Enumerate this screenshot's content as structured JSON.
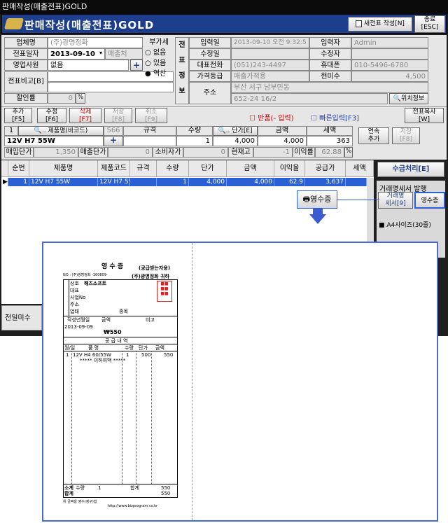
{
  "window_title": "판매작성(매출전표)GOLD",
  "header": {
    "title": "판매작성(매출전표)GOLD",
    "new_label": "새전표 작성[N]",
    "close_label": "종료\n[ESC]"
  },
  "form": {
    "company_label": "업체명",
    "company_value": "(주)광명정화",
    "date_label": "전표일자",
    "date_value": "2013-09-10",
    "sale_placeholder": "매출처",
    "sales_label": "영업사원",
    "sales_value": "없음",
    "plus": "+",
    "memo_label": "전표비고[B]",
    "discount_label": "할인률",
    "discount_value": "0",
    "pct": "%",
    "vat_label": "부가세",
    "vat_options": [
      "없음",
      "있음",
      "역산"
    ],
    "vat_selected": "역산"
  },
  "info": {
    "side": [
      "전",
      "표",
      "정",
      "보"
    ],
    "rows": [
      {
        "l1": "입력일",
        "v1": "2013-09-10 오전 9:32:5",
        "l2": "입력자",
        "v2": "Admin"
      },
      {
        "l1": "수정일",
        "v1": "",
        "l2": "수정자",
        "v2": ""
      },
      {
        "l1": "대표전화",
        "v1": "(051)243-4497",
        "l2": "휴대폰",
        "v2": "010-5496-6780"
      },
      {
        "l1": "가격등급",
        "v1": "매출가적용",
        "l2": "현미수",
        "v2": "4,500"
      }
    ],
    "addr_label": "주소",
    "addr1": "부산 서구 남부민동",
    "addr2": "652-24 16/2",
    "location_btn": "위치정보"
  },
  "toolbar": {
    "add": "추가\n[F5]",
    "edit": "수정\n[F6]",
    "del": "삭제\n[F7]",
    "save": "저장\n[F8]",
    "cancel": "취소\n[F9]",
    "return_label": "반품(- 입력)",
    "quick_label": "빠른입력[F3]",
    "copy": "전표복사\n[W]"
  },
  "entry": {
    "no": "1",
    "product_head": ".. 제품명(바코드)",
    "code_head": "566",
    "spec_head": "규격",
    "qty_head": "수량",
    "price_head": ".. 단가[E]",
    "amount_head": "금액",
    "tax_head": "세액",
    "product": "12V H7 55W",
    "qty": "1",
    "price": "4,000",
    "amount": "4,000",
    "tax": "363",
    "cont_add": "연속\n추가",
    "save": "저장\n[F8]",
    "buy_label": "매입단가",
    "buy": "1,350",
    "sell_label": "매출단가",
    "sell": "0",
    "cons_label": "소비자가",
    "cons": "0",
    "stock_label": "현재고",
    "stock": "-1",
    "margin_label": "이익률",
    "margin": "62.88",
    "pct": "%"
  },
  "grid": {
    "headers": [
      "순번",
      "제품명",
      "제품코드",
      "규격",
      "수량",
      "단가",
      "금액",
      "이익율",
      "공급가",
      "세액"
    ],
    "row": [
      "1",
      "12V H7 55W",
      "12V H7 55",
      "",
      "1",
      "4,000",
      "4,000",
      "62.9",
      "3,637",
      ""
    ]
  },
  "right": {
    "collect": "수금처리[E]",
    "stmt_title": "거래명세서 발행",
    "stmt_btn": "거래명\n세서[9]",
    "receipt_btn": "영수증",
    "a4": "A4사이즈(30줄)"
  },
  "receipt_popup": "영수증",
  "bottom": {
    "prev_label": "전일미수"
  },
  "receipt": {
    "title": "영 수 증",
    "sub": "(공급받는자용)",
    "no": "NO : (주)광명정화 -160609-",
    "to": "(주)광명정화 귀하",
    "sup_rows": [
      [
        "상호",
        "해즈소프트"
      ],
      [
        "대표",
        ""
      ],
      [
        "사업No",
        ""
      ],
      [
        "주소",
        ""
      ],
      [
        "업태",
        "종목"
      ]
    ],
    "hdr": [
      "작성년월일",
      "금액",
      "비고"
    ],
    "date": "2013-09-09",
    "total": "₩550",
    "detail": "공 급 내 역",
    "cols": [
      "월/일",
      "품 명",
      "수량",
      "단가",
      "금액"
    ],
    "item": [
      "1",
      "12V H4 60/55W",
      "1",
      "500",
      "550"
    ],
    "below": "***** 이하여백 *****",
    "sum_label": "소계",
    "tot_label": "합계",
    "qty_label": "수량",
    "qty": "1",
    "sum": "550",
    "footer": "위 금액을 영수(청구)함",
    "footer2": "http://www.bizprogram.co.kr"
  }
}
